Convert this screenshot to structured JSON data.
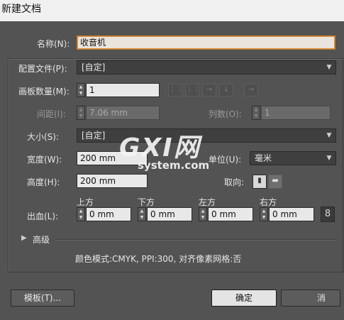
{
  "window": {
    "title": "新建文档"
  },
  "name": {
    "label": "名称(N):",
    "value": "收音机"
  },
  "profile": {
    "label": "配置文件(P):",
    "value": "[自定]"
  },
  "artboards": {
    "count_label": "画板数量(M):",
    "count_value": "1",
    "spacing_label": "间距(I):",
    "spacing_value": "7.06 mm",
    "columns_label": "列数(O):",
    "columns_value": "1"
  },
  "size": {
    "label": "大小(S):",
    "value": "[自定]"
  },
  "width": {
    "label": "宽度(W):",
    "value": "200 mm"
  },
  "units": {
    "label": "单位(U):",
    "value": "毫米"
  },
  "height": {
    "label": "高度(H):",
    "value": "200 mm"
  },
  "orientation": {
    "label": "取向:"
  },
  "bleed": {
    "label": "出血(L):",
    "top_label": "上方",
    "top_value": "0 mm",
    "bottom_label": "下方",
    "bottom_value": "0 mm",
    "left_label": "左方",
    "left_value": "0 mm",
    "right_label": "右方",
    "right_value": "0 mm"
  },
  "advanced": {
    "label": "高级"
  },
  "summary": {
    "text": "颜色模式:CMYK, PPI:300, 对齐像素网格:否"
  },
  "buttons": {
    "templates": "模板(T)...",
    "ok": "确定",
    "cancel": "消"
  },
  "watermark": {
    "brand": "GXI网",
    "domain": "system.com"
  }
}
